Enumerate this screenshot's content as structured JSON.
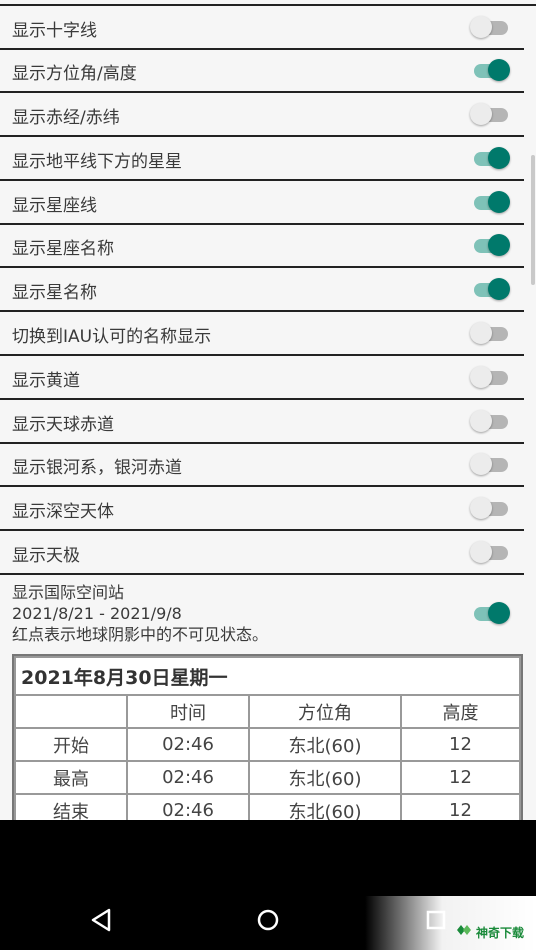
{
  "settings": [
    {
      "label": "显示十字线",
      "on": false
    },
    {
      "label": "显示方位角/高度",
      "on": true
    },
    {
      "label": "显示赤经/赤纬",
      "on": false
    },
    {
      "label": "显示地平线下方的星星",
      "on": true
    },
    {
      "label": "显示星座线",
      "on": true
    },
    {
      "label": "显示星座名称",
      "on": true
    },
    {
      "label": "显示星名称",
      "on": true
    },
    {
      "label": "切换到IAU认可的名称显示",
      "on": false
    },
    {
      "label": "显示黄道",
      "on": false
    },
    {
      "label": "显示天球赤道",
      "on": false
    },
    {
      "label": "显示银河系，银河赤道",
      "on": false
    },
    {
      "label": "显示深空天体",
      "on": false
    },
    {
      "label": "显示天极",
      "on": false
    }
  ],
  "iss": {
    "label": "显示国际空间站",
    "date_range": "2021/8/21 - 2021/9/8",
    "note": "红点表示地球阴影中的不可见状态。",
    "on": true
  },
  "table": {
    "date": "2021年8月30日星期一",
    "headers": [
      "",
      "时间",
      "方位角",
      "高度"
    ],
    "rows": [
      [
        "开始",
        "02:46",
        "东北(60)",
        "12"
      ],
      [
        "最高",
        "02:46",
        "东北(60)",
        "12"
      ],
      [
        "结束",
        "02:46",
        "东北(60)",
        "12"
      ]
    ]
  },
  "colors": {
    "toggle_on": "#00796b",
    "toggle_on_track": "#7fc2b8",
    "toggle_off_track": "#b5b5b5"
  },
  "navbar": {
    "back_icon": "triangle-back-icon",
    "home_icon": "circle-home-icon",
    "recents_icon": "square-recents-icon"
  },
  "watermark": {
    "text": "神奇下载"
  }
}
